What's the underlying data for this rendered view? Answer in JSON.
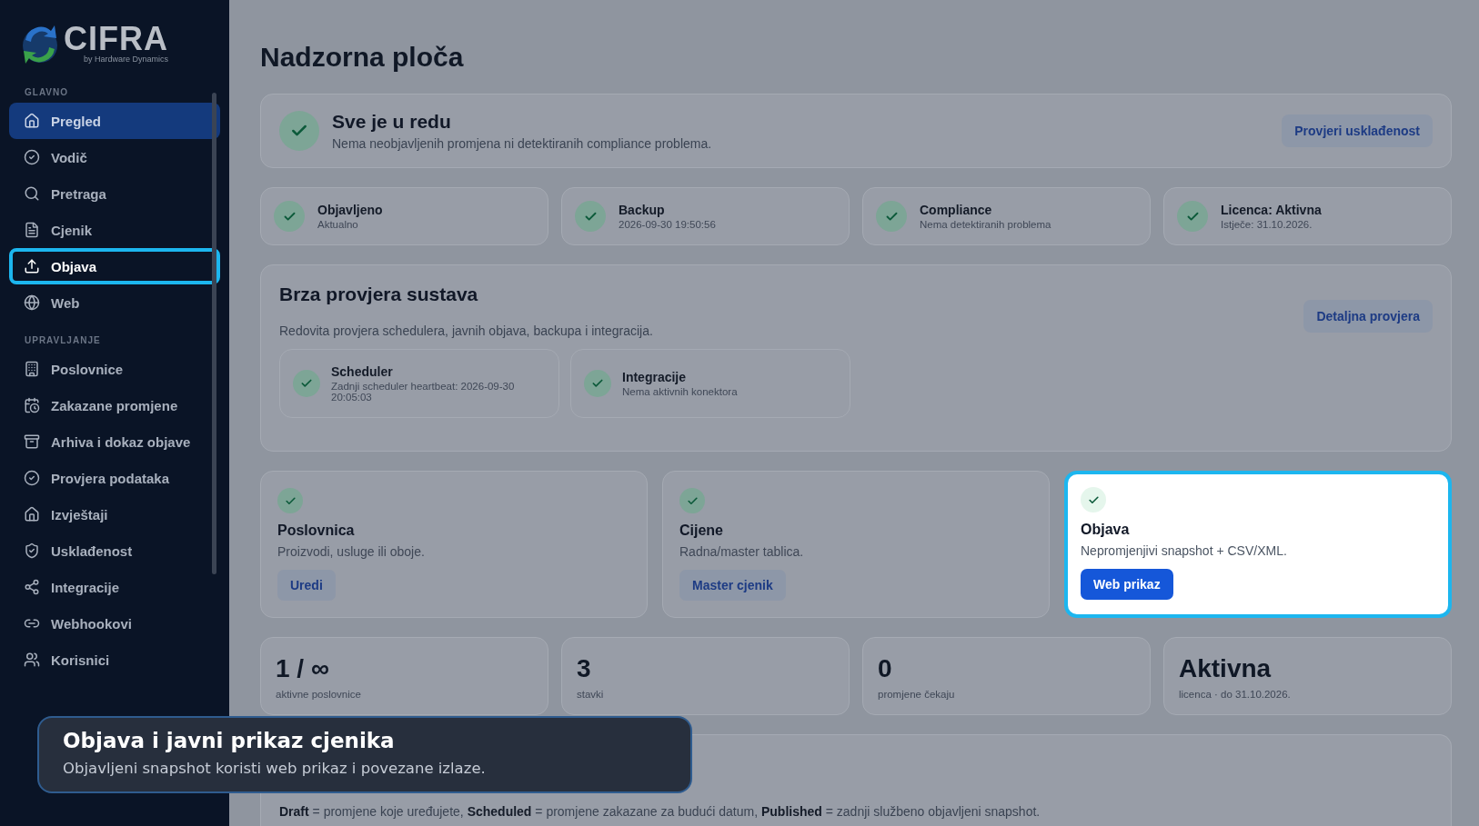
{
  "logo": {
    "name": "CIFRA",
    "tagline": "by Hardware Dynamics"
  },
  "sidebar": {
    "sections": [
      {
        "label": "GLAVNO",
        "items": [
          {
            "label": "Pregled",
            "selected": true,
            "highlighted": false
          },
          {
            "label": "Vodič",
            "selected": false,
            "highlighted": false
          },
          {
            "label": "Pretraga",
            "selected": false,
            "highlighted": false
          },
          {
            "label": "Cjenik",
            "selected": false,
            "highlighted": false
          },
          {
            "label": "Objava",
            "selected": false,
            "highlighted": true
          },
          {
            "label": "Web",
            "selected": false,
            "highlighted": false
          }
        ]
      },
      {
        "label": "UPRAVLJANJE",
        "items": [
          {
            "label": "Poslovnice",
            "selected": false,
            "highlighted": false
          },
          {
            "label": "Zakazane promjene",
            "selected": false,
            "highlighted": false
          },
          {
            "label": "Arhiva i dokaz objave",
            "selected": false,
            "highlighted": false
          },
          {
            "label": "Provjera podataka",
            "selected": false,
            "highlighted": false
          },
          {
            "label": "Izvještaji",
            "selected": false,
            "highlighted": false
          },
          {
            "label": "Usklađenost",
            "selected": false,
            "highlighted": false
          },
          {
            "label": "Integracije",
            "selected": false,
            "highlighted": false
          },
          {
            "label": "Webhookovi",
            "selected": false,
            "highlighted": false
          },
          {
            "label": "Korisnici",
            "selected": false,
            "highlighted": false
          }
        ]
      }
    ]
  },
  "page_title": "Nadzorna ploča",
  "banner": {
    "title": "Sve je u redu",
    "text": "Nema neobjavljenih promjena ni detektiranih compliance problema.",
    "button": "Provjeri usklađenost"
  },
  "status_cards": [
    {
      "title": "Objavljeno",
      "subtitle": "Aktualno"
    },
    {
      "title": "Backup",
      "subtitle": "2026-09-30 19:50:56"
    },
    {
      "title": "Compliance",
      "subtitle": "Nema detektiranih problema"
    },
    {
      "title": "Licenca: Aktivna",
      "subtitle": "Istječe: 31.10.2026."
    }
  ],
  "quick_check": {
    "title": "Brza provjera sustava",
    "description": "Redovita provjera schedulera, javnih objava, backupa i integracija.",
    "button": "Detaljna provjera",
    "checks": [
      {
        "title": "Scheduler",
        "subtitle": "Zadnji scheduler heartbeat: 2026-09-30 20:05:03"
      },
      {
        "title": "Integracije",
        "subtitle": "Nema aktivnih konektora"
      }
    ]
  },
  "feature_cards": [
    {
      "title": "Poslovnica",
      "description": "Proizvodi, usluge ili oboje.",
      "button": "Uredi",
      "highlighted": false
    },
    {
      "title": "Cijene",
      "description": "Radna/master tablica.",
      "button": "Master cjenik",
      "highlighted": false
    },
    {
      "title": "Objava",
      "description": "Nepromjenjivi snapshot + CSV/XML.",
      "button": "Web prikaz",
      "highlighted": true
    }
  ],
  "stats": [
    {
      "value": "1 / ∞",
      "caption": "aktivne poslovnice"
    },
    {
      "value": "3",
      "caption": "stavki"
    },
    {
      "value": "0",
      "caption": "promjene čekaju"
    },
    {
      "value": "Aktivna",
      "caption": "licenca · do 31.10.2026."
    }
  ],
  "legend": "**Draft** = promjene koje uređujete, **Scheduled** = promjene zakazane za budući datum, **Published** = zadnji službeno objavljeni snapshot.",
  "tooltip": {
    "title": "Objava i javni prikaz cjenika",
    "text": "Objavljeni snapshot koristi web prikaz i povezane izlaze."
  }
}
